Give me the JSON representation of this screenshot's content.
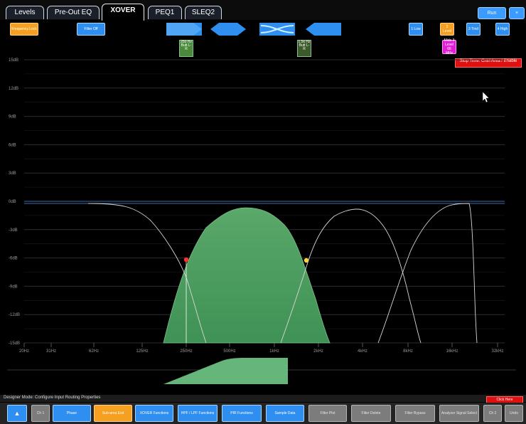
{
  "tabs": [
    {
      "label": "Levels",
      "active": false
    },
    {
      "label": "Pre-Out EQ",
      "active": false
    },
    {
      "label": "XOVER",
      "active": true
    },
    {
      "label": "PEQ1",
      "active": false
    },
    {
      "label": "SLEQ2",
      "active": false
    }
  ],
  "top_right": {
    "run_label": "Run",
    "close_label": "×"
  },
  "toolbar": {
    "frequency_lock": "Frequency Lock",
    "filter_off": "Filter Off",
    "filter_shapes": [
      "HPF",
      "BPF",
      "XOVER",
      "LPF"
    ],
    "tags": [
      "250 Hz Butt L-R",
      "1.5k Hz Butt L-R"
    ],
    "levels": [
      "1 Low",
      "2 Level",
      "3 Trnd",
      "4 High"
    ],
    "mode_tag": "Mids 3 Level 66 MHz"
  },
  "warning": "Stop Time: Cntrl Area / Enable",
  "graph": {
    "y_labels": [
      "15dB",
      "12dB",
      "9dB",
      "6dB",
      "3dB",
      "0dB",
      "-3dB",
      "-6dB",
      "-9dB",
      "-12dB",
      "-15dB"
    ],
    "x_labels": [
      "20Hz",
      "31Hz",
      "62Hz",
      "125Hz",
      "250Hz",
      "500Hz",
      "1kHz",
      "2kHz",
      "4kHz",
      "8kHz",
      "16kHz",
      "32kHz"
    ]
  },
  "status_text": "Designer Mode: Configure Input Routing Properties",
  "status_right": "Click Here",
  "bottom_buttons": [
    {
      "label": "",
      "style": "blue"
    },
    {
      "label": "Ch 1",
      "style": "gray"
    },
    {
      "label": "Phase",
      "style": "blue"
    },
    {
      "label": "Sub-area Exit",
      "style": "orange"
    },
    {
      "label": "XOVER Functions",
      "style": "blue"
    },
    {
      "label": "HPF / LPF Functions",
      "style": "blue"
    },
    {
      "label": "PIR Functions",
      "style": "blue"
    },
    {
      "label": "Sample Data",
      "style": "blue"
    },
    {
      "label": "Filter Plot",
      "style": "gray"
    },
    {
      "label": "Filter Delete",
      "style": "gray"
    },
    {
      "label": "Filter Bypass",
      "style": "gray"
    },
    {
      "label": "Analyzer Signal Select",
      "style": "gray"
    },
    {
      "label": "Ch 2",
      "style": "gray"
    },
    {
      "label": "Undo",
      "style": "gray"
    }
  ]
}
